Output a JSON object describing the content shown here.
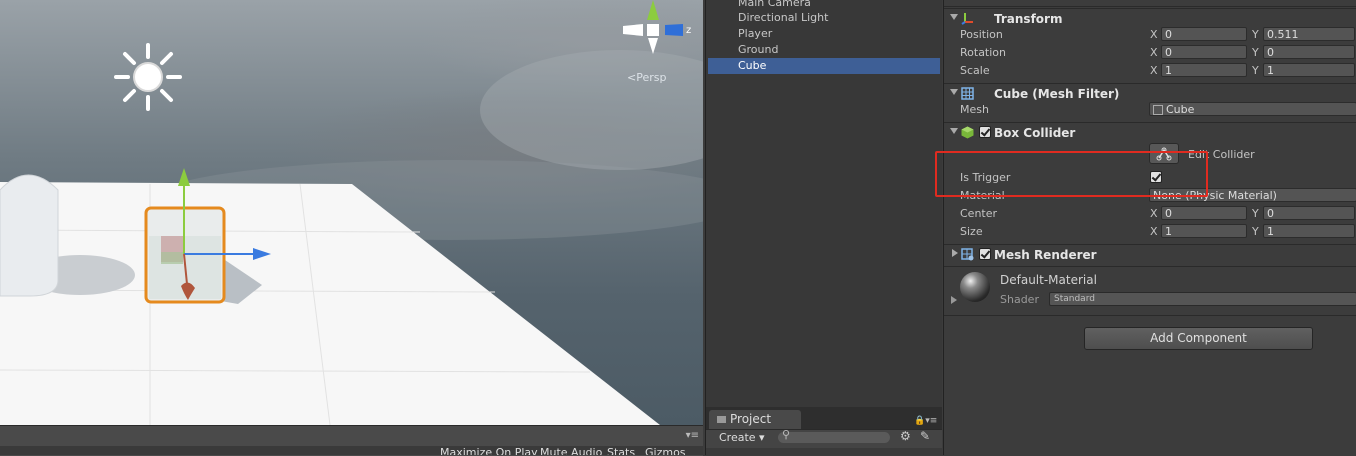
{
  "scene": {
    "projection_label": "Persp",
    "gizmo_axis_label": "z",
    "menu_icon": "menu-icon"
  },
  "game_toolbar": {
    "maximize_on_play": "Maximize On Play",
    "mute_audio": "Mute Audio",
    "stats": "Stats",
    "gizmos": "Gizmos"
  },
  "hierarchy": {
    "items": [
      {
        "label": "Main Camera",
        "selected": false
      },
      {
        "label": "Directional Light",
        "selected": false
      },
      {
        "label": "Player",
        "selected": false
      },
      {
        "label": "Ground",
        "selected": false
      },
      {
        "label": "Cube",
        "selected": true
      }
    ]
  },
  "project": {
    "tab_label": "Project",
    "create_label": "Create ▾",
    "search_placeholder": ""
  },
  "inspector": {
    "transform": {
      "title": "Transform",
      "position_label": "Position",
      "rotation_label": "Rotation",
      "scale_label": "Scale",
      "position": {
        "x": "0",
        "y": "0.511"
      },
      "rotation": {
        "x": "0",
        "y": "0"
      },
      "scale": {
        "x": "1",
        "y": "1"
      }
    },
    "mesh_filter": {
      "title": "Cube (Mesh Filter)",
      "mesh_label": "Mesh",
      "mesh_value": "Cube"
    },
    "box_collider": {
      "title": "Box Collider",
      "edit_collider_label": "Edit Collider",
      "is_trigger_label": "Is Trigger",
      "is_trigger": true,
      "material_label": "Material",
      "material_value": "None (Physic Material)",
      "center_label": "Center",
      "center": {
        "x": "0",
        "y": "0"
      },
      "size_label": "Size",
      "size": {
        "x": "1",
        "y": "1"
      }
    },
    "mesh_renderer": {
      "title": "Mesh Renderer"
    },
    "material": {
      "name": "Default-Material",
      "shader_label": "Shader",
      "shader_value": "Standard"
    },
    "add_component_label": "Add Component",
    "axis_x": "X",
    "axis_y": "Y"
  },
  "colors": {
    "selection": "#3e5f96",
    "highlight": "#e02b20",
    "object_outline": "#e58a1e"
  }
}
